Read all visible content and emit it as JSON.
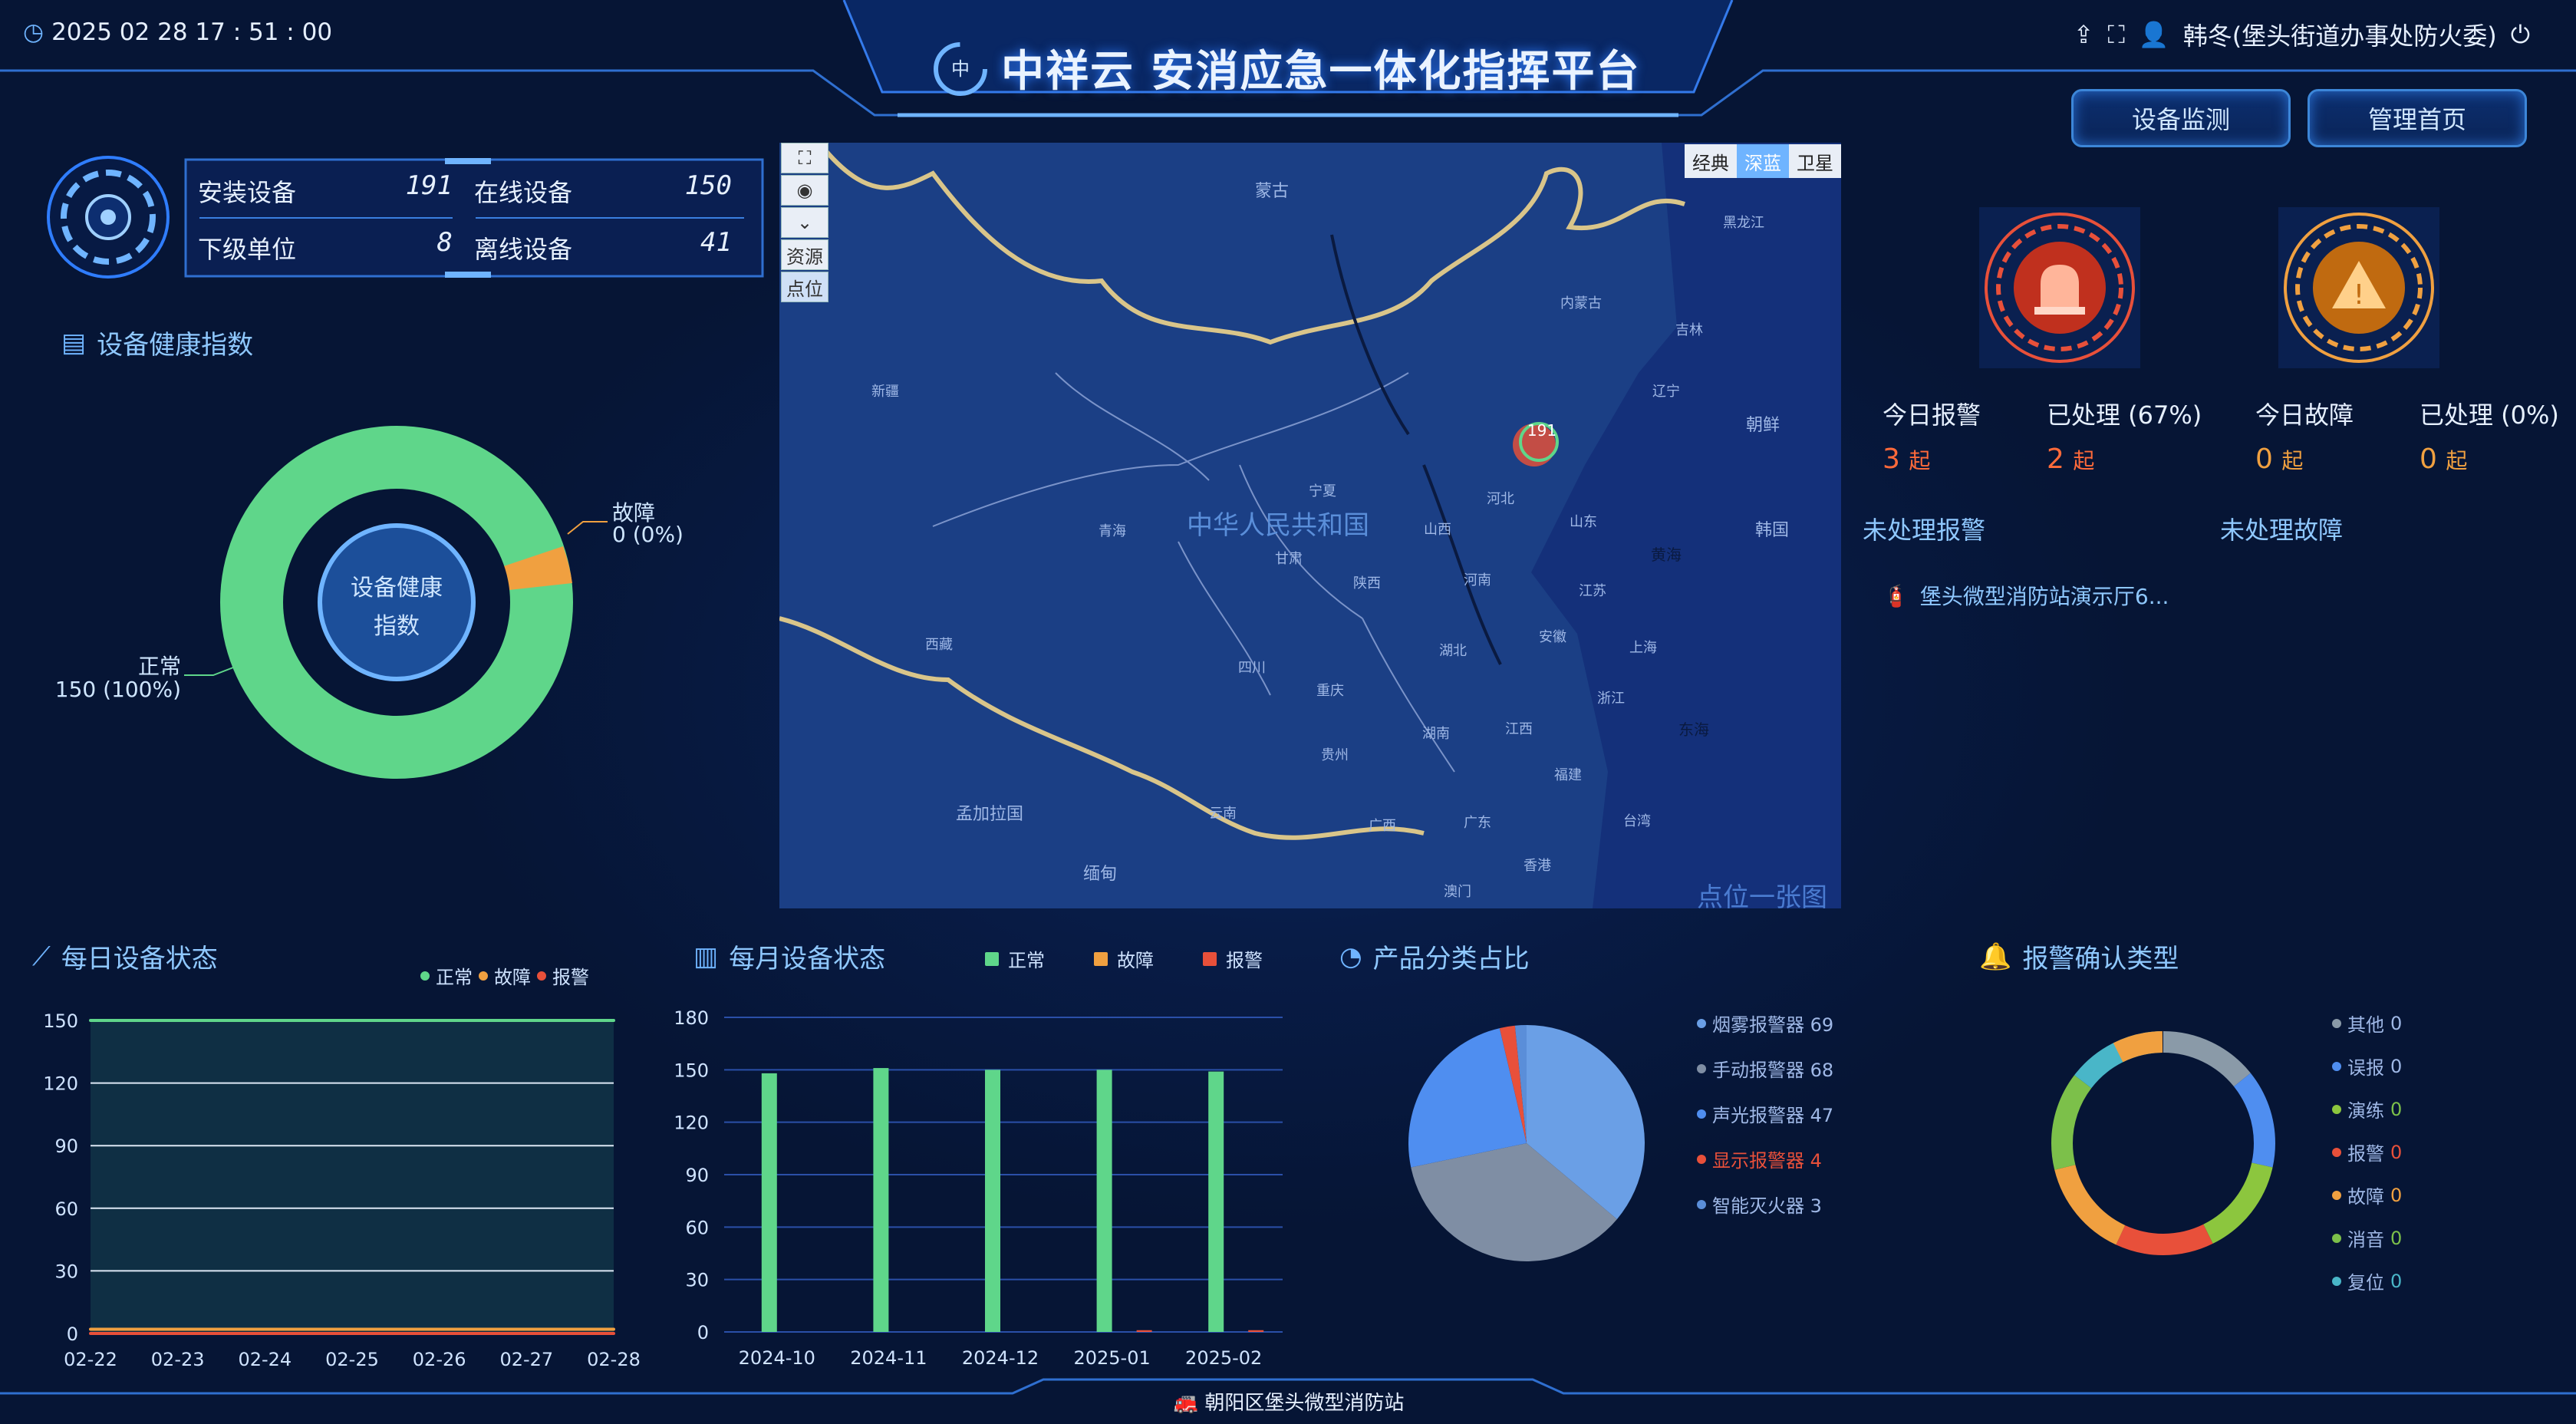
{
  "header": {
    "datetime": "2025 02 28 17 : 51 : 00",
    "title": "中祥云 安消应急一体化指挥平台",
    "logo_text": "中祥云",
    "user": "韩冬(堡头街道办事处防火委)"
  },
  "nav": {
    "device_monitor": "设备监测",
    "admin_home": "管理首页"
  },
  "stats": {
    "installed_label": "安装设备",
    "installed": "191",
    "online_label": "在线设备",
    "online": "150",
    "sub_label": "下级单位",
    "sub": "8",
    "offline_label": "离线设备",
    "offline": "41"
  },
  "health": {
    "title": "设备健康指数",
    "center_line1": "设备健康",
    "center_line2": "指数",
    "fault_label": "故障",
    "fault_value": "0 (0%)",
    "normal_label": "正常",
    "normal_value": "150 (100%)"
  },
  "map": {
    "buttons": [
      "资源",
      "点位"
    ],
    "types": [
      "经典",
      "深蓝",
      "卫星"
    ],
    "country": "中华人民共和国",
    "marker": "191",
    "caption": "点位一张图",
    "labels": [
      "蒙古",
      "黑龙江",
      "内蒙古",
      "吉林",
      "新疆",
      "辽宁",
      "朝鲜",
      "河北",
      "宁夏",
      "山西",
      "山东",
      "韩国",
      "黄海",
      "青海",
      "甘肃",
      "陕西",
      "河南",
      "江苏",
      "西藏",
      "四川",
      "湖北",
      "安徽",
      "上海",
      "重庆",
      "浙江",
      "东海",
      "湖南",
      "江西",
      "贵州",
      "福建",
      "云南",
      "广西",
      "广东",
      "台湾",
      "香港",
      "澳门",
      "孟加拉国",
      "缅甸"
    ]
  },
  "alarm": {
    "today_alarm_label": "今日报警",
    "today_alarm": "3",
    "processed_label": "已处理 (67%)",
    "processed": "2",
    "today_fault_label": "今日故障",
    "today_fault": "0",
    "fault_processed_label": "已处理 (0%)",
    "fault_processed": "0",
    "unit": "起",
    "unhandled_alarm": "未处理报警",
    "unhandled_fault": "未处理故障",
    "alarm_item": "堡头微型消防站演示厅6..."
  },
  "daily": {
    "title": "每日设备状态",
    "legend": [
      "正常",
      "故障",
      "报警"
    ]
  },
  "monthly": {
    "title": "每月设备状态",
    "legend": [
      "正常",
      "故障",
      "报警"
    ]
  },
  "product": {
    "title": "产品分类占比",
    "items": [
      {
        "name": "烟雾报警器",
        "value": "69"
      },
      {
        "name": "手动报警器",
        "value": "68"
      },
      {
        "name": "声光报警器",
        "value": "47"
      },
      {
        "name": "显示报警器",
        "value": "4"
      },
      {
        "name": "智能灭火器",
        "value": "3"
      }
    ]
  },
  "confirm": {
    "title": "报警确认类型",
    "items": [
      {
        "name": "其他",
        "value": "0"
      },
      {
        "name": "误报",
        "value": "0"
      },
      {
        "name": "演练",
        "value": "0"
      },
      {
        "name": "报警",
        "value": "0"
      },
      {
        "name": "故障",
        "value": "0"
      },
      {
        "name": "消音",
        "value": "0"
      },
      {
        "name": "复位",
        "value": "0"
      }
    ]
  },
  "footer": {
    "station": "朝阳区堡头微型消防站"
  },
  "colors": {
    "normal": "#5fd68a",
    "fault": "#f0a040",
    "alarm": "#e8503a",
    "accent": "#3c86d8"
  },
  "chart_data": [
    {
      "type": "donut",
      "title": "设备健康指数",
      "categories": [
        "正常",
        "故障"
      ],
      "values": [
        150,
        0
      ]
    },
    {
      "type": "line",
      "title": "每日设备状态",
      "categories": [
        "02-22",
        "02-23",
        "02-24",
        "02-25",
        "02-26",
        "02-27",
        "02-28"
      ],
      "series": [
        {
          "name": "正常",
          "values": [
            150,
            150,
            150,
            150,
            150,
            150,
            150
          ]
        },
        {
          "name": "故障",
          "values": [
            2,
            2,
            2,
            2,
            2,
            2,
            2
          ]
        },
        {
          "name": "报警",
          "values": [
            0,
            0,
            0,
            0,
            0,
            0,
            0
          ]
        }
      ],
      "ylim": [
        0,
        150
      ],
      "yticks": [
        0,
        30,
        60,
        90,
        120,
        150
      ]
    },
    {
      "type": "bar",
      "title": "每月设备状态",
      "categories": [
        "2024-10",
        "2024-11",
        "2024-12",
        "2025-01",
        "2025-02"
      ],
      "series": [
        {
          "name": "正常",
          "values": [
            148,
            151,
            150,
            150,
            149
          ]
        },
        {
          "name": "故障",
          "values": [
            0,
            0,
            0,
            0,
            0
          ]
        },
        {
          "name": "报警",
          "values": [
            0,
            0,
            0,
            1,
            1
          ]
        }
      ],
      "ylim": [
        0,
        180
      ],
      "yticks": [
        0,
        30,
        60,
        90,
        120,
        150,
        180
      ]
    },
    {
      "type": "pie",
      "title": "产品分类占比",
      "categories": [
        "烟雾报警器",
        "手动报警器",
        "声光报警器",
        "显示报警器",
        "智能灭火器"
      ],
      "values": [
        69,
        68,
        47,
        4,
        3
      ]
    },
    {
      "type": "donut",
      "title": "报警确认类型",
      "categories": [
        "其他",
        "误报",
        "演练",
        "报警",
        "故障",
        "消音",
        "复位"
      ],
      "values": [
        0,
        0,
        0,
        0,
        0,
        0,
        0
      ]
    }
  ]
}
